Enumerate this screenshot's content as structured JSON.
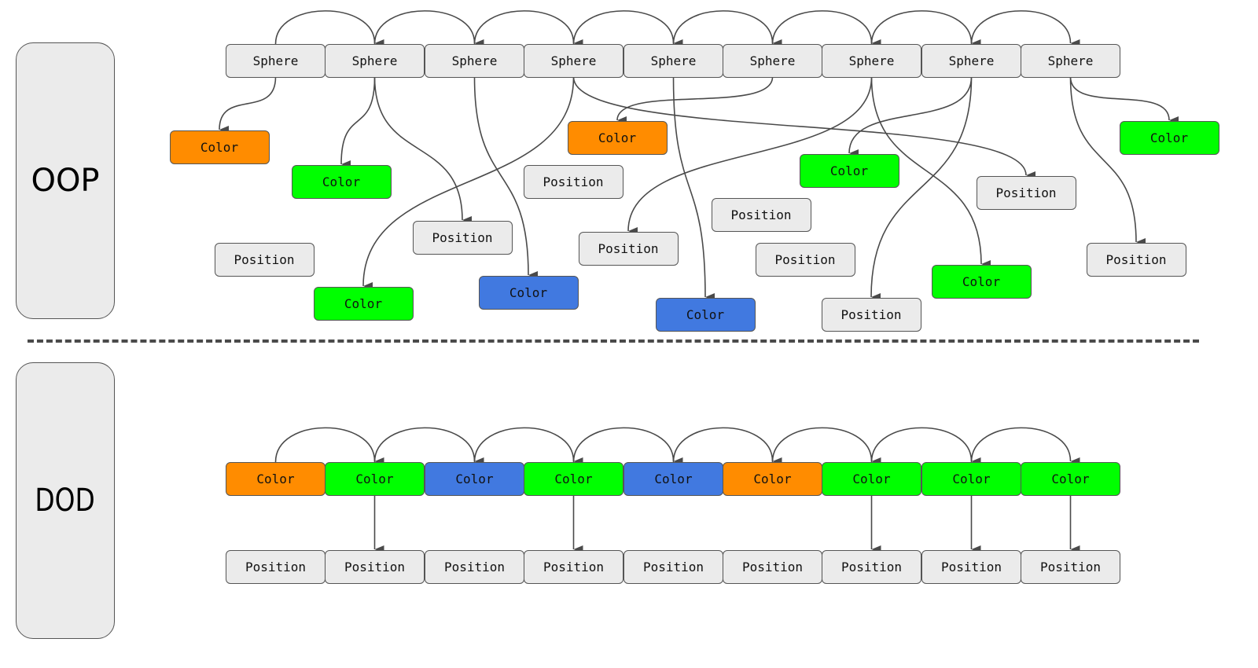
{
  "colors": {
    "node_gray": "#ebebeb",
    "orange": "#ff8c00",
    "green": "#00ff00",
    "blue": "#4179e0",
    "edge": "#4a4a4a"
  },
  "sections": {
    "oop": {
      "label": "OOP",
      "spheres": [
        "Sphere",
        "Sphere",
        "Sphere",
        "Sphere",
        "Sphere",
        "Sphere",
        "Sphere",
        "Sphere",
        "Sphere"
      ],
      "components": [
        {
          "id": "c1",
          "label": "Color",
          "kind": "orange",
          "owner": 0
        },
        {
          "id": "c2",
          "label": "Color",
          "kind": "green",
          "owner": 1
        },
        {
          "id": "p2",
          "label": "Position",
          "kind": "gray",
          "owner": 1
        },
        {
          "id": "c3",
          "label": "Color",
          "kind": "blue",
          "owner": 2
        },
        {
          "id": "c4",
          "label": "Color",
          "kind": "green",
          "owner": 3
        },
        {
          "id": "p4",
          "label": "Position",
          "kind": "gray",
          "owner": 3
        },
        {
          "id": "c5",
          "label": "Color",
          "kind": "blue",
          "owner": 4
        },
        {
          "id": "c6",
          "label": "Color",
          "kind": "orange",
          "owner": 5
        },
        {
          "id": "p7",
          "label": "Position",
          "kind": "gray",
          "owner": 6
        },
        {
          "id": "c7",
          "label": "Color",
          "kind": "green",
          "owner": 6
        },
        {
          "id": "c8",
          "label": "Color",
          "kind": "green",
          "owner": 7
        },
        {
          "id": "p8",
          "label": "Position",
          "kind": "gray",
          "owner": 7
        },
        {
          "id": "c9",
          "label": "Color",
          "kind": "green",
          "owner": 8
        },
        {
          "id": "p9",
          "label": "Position",
          "kind": "gray",
          "owner": 8
        },
        {
          "id": "pa",
          "label": "Position",
          "kind": "gray",
          "owner": null
        },
        {
          "id": "pb",
          "label": "Position",
          "kind": "gray",
          "owner": null
        },
        {
          "id": "pc",
          "label": "Position",
          "kind": "gray",
          "owner": null
        },
        {
          "id": "pd",
          "label": "Position",
          "kind": "gray",
          "owner": null
        }
      ]
    },
    "dod": {
      "label": "DOD",
      "colors": [
        {
          "label": "Color",
          "kind": "orange"
        },
        {
          "label": "Color",
          "kind": "green"
        },
        {
          "label": "Color",
          "kind": "blue"
        },
        {
          "label": "Color",
          "kind": "green"
        },
        {
          "label": "Color",
          "kind": "blue"
        },
        {
          "label": "Color",
          "kind": "orange"
        },
        {
          "label": "Color",
          "kind": "green"
        },
        {
          "label": "Color",
          "kind": "green"
        },
        {
          "label": "Color",
          "kind": "green"
        }
      ],
      "positions": [
        "Position",
        "Position",
        "Position",
        "Position",
        "Position",
        "Position",
        "Position",
        "Position",
        "Position"
      ],
      "color_to_position_links": [
        1,
        3,
        6,
        7,
        8
      ]
    }
  }
}
